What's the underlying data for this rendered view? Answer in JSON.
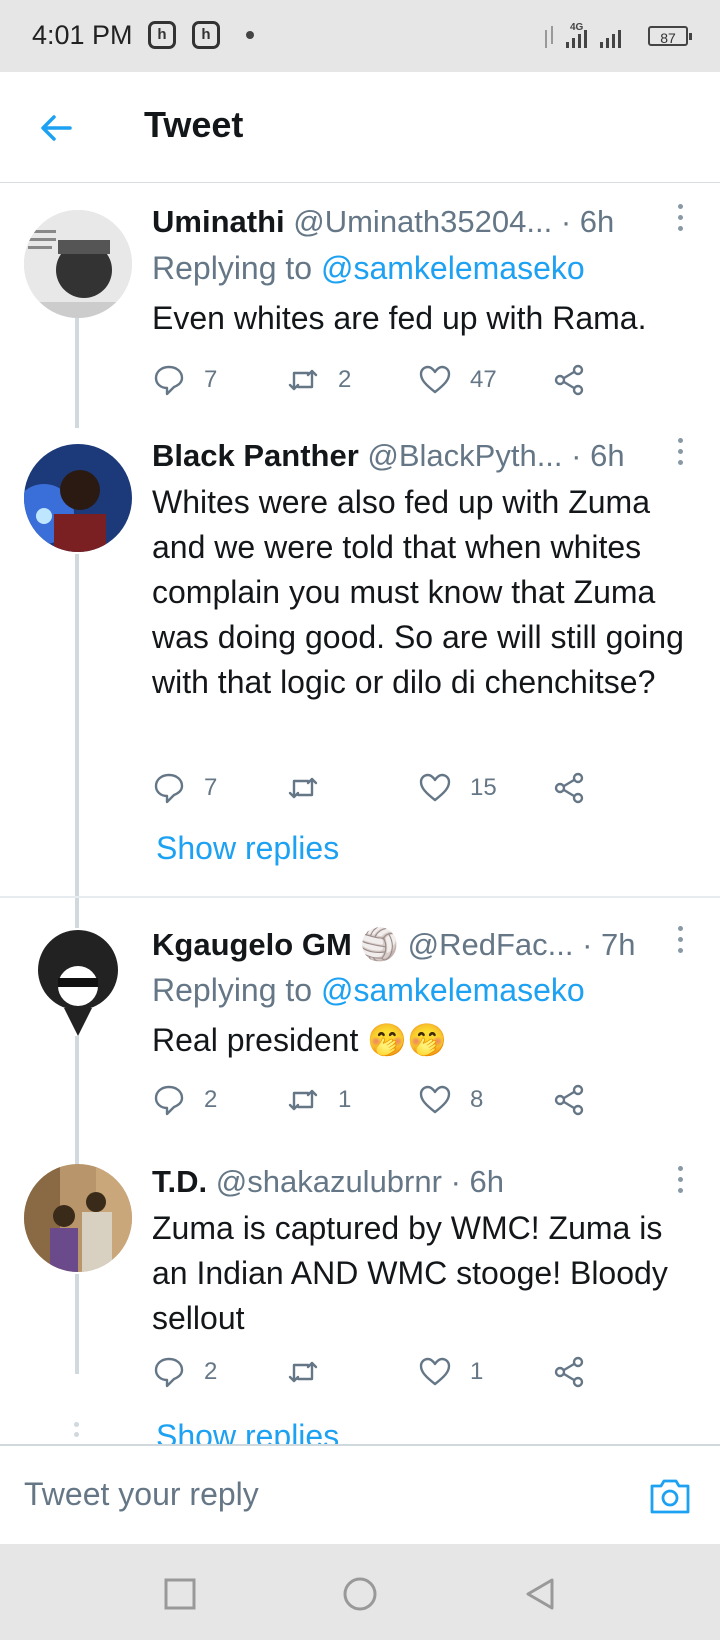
{
  "status_bar": {
    "time": "4:01 PM",
    "app_icon_label": "h",
    "network": "4G",
    "battery": "87"
  },
  "header": {
    "title": "Tweet"
  },
  "tweets": [
    {
      "name": "Uminathi",
      "handle": "@Uminath35204...",
      "time": "· 6h",
      "replying_label": "Replying to",
      "replying_to": "@samkelemaseko",
      "text": "Even whites are fed up with Rama.",
      "replies": "7",
      "retweets": "2",
      "likes": "47"
    },
    {
      "name": "Black Panther",
      "handle": "@BlackPyth...",
      "time": "· 6h",
      "text": "Whites were also fed up with Zuma and we were told that when whites complain you must know that Zuma was doing good. So are will still going with that logic or dilo di chenchitse?",
      "replies": "7",
      "retweets": "",
      "likes": "15",
      "show_replies": "Show replies"
    },
    {
      "name": "Kgaugelo GM",
      "badge": "🏐",
      "handle": "@RedFac...",
      "time": "· 7h",
      "replying_label": "Replying to",
      "replying_to": "@samkelemaseko",
      "text": "Real president 🤭🤭",
      "replies": "2",
      "retweets": "1",
      "likes": "8"
    },
    {
      "name": "T.D.",
      "handle": "@shakazulubrnr",
      "time": "· 6h",
      "text": "Zuma is captured by WMC! Zuma is an Indian AND WMC stooge! Bloody sellout",
      "replies": "2",
      "retweets": "",
      "likes": "1",
      "show_replies": "Show replies"
    }
  ],
  "composer": {
    "placeholder": "Tweet your reply"
  },
  "colors": {
    "accent": "#1da1f2",
    "text": "#14171a",
    "muted": "#657786"
  }
}
